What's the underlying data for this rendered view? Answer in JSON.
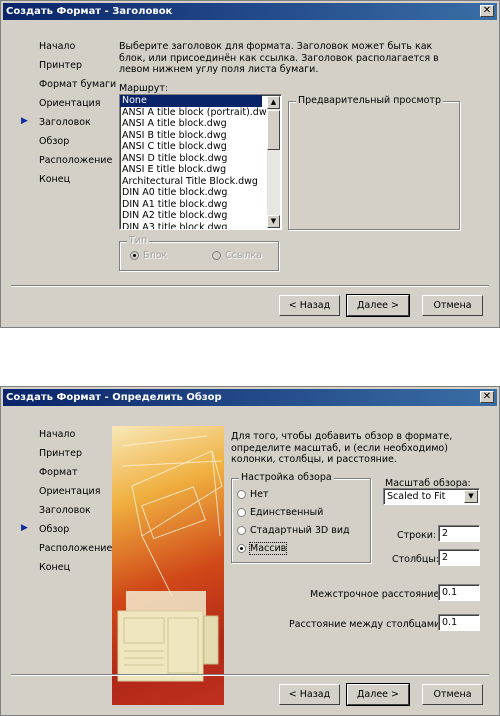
{
  "dialog1": {
    "title": "Создать Формат - Заголовок",
    "nav": [
      "Начало",
      "Принтер",
      "Формат бумаги",
      "Ориентация",
      "Заголовок",
      "Обзор",
      "Расположение",
      "Конец"
    ],
    "active_index": 4,
    "description": "Выберите заголовок для формата. Заголовок может быть как блок, или присоединён как ссылка. Заголовок располагается в левом нижнем углу поля листа бумаги.",
    "path_label": "Маршрут:",
    "list_items": [
      "None",
      "ANSI A title block (portrait).dwg",
      "ANSI A title block.dwg",
      "ANSI B title block.dwg",
      "ANSI C title block.dwg",
      "ANSI D title block.dwg",
      "ANSI E title block.dwg",
      "Architectural Title Block.dwg",
      "DIN A0 title block.dwg",
      "DIN A1 title block.dwg",
      "DIN A2 title block.dwg",
      "DIN A3 title block.dwg"
    ],
    "selected_item": "None",
    "preview_label": "Предварительный просмотр",
    "type_group": "Тип",
    "type_options": [
      "Блок",
      "Ссылка"
    ],
    "back": "< Назад",
    "next": "Далее >",
    "cancel": "Отмена"
  },
  "dialog2": {
    "title": "Создать Формат - Определить Обзор",
    "nav": [
      "Начало",
      "Принтер",
      "Формат",
      "Ориентация",
      "Заголовок",
      "Обзор",
      "Расположение",
      "Конец"
    ],
    "active_index": 5,
    "description": "Для того, чтобы добавить обзор в формате, определите масштаб, и (если необходимо) колонки, столбцы, и расстояние.",
    "view_group": "Настройка обзора",
    "view_options": [
      "Нет",
      "Единственный",
      "Стадартный 3D вид",
      "Массив"
    ],
    "view_selected": "Массив",
    "scale_label": "Масштаб обзора:",
    "scale_value": "Scaled to Fit",
    "rows_label": "Строки:",
    "rows_value": "2",
    "cols_label": "Столбцы:",
    "cols_value": "2",
    "row_spacing_label": "Межстрочное расстояние:",
    "row_spacing_value": "0.1",
    "col_spacing_label": "Расстояние между столбцами:",
    "col_spacing_value": "0.1",
    "back": "< Назад",
    "next": "Далее >",
    "cancel": "Отмена"
  },
  "colors": {
    "titlebar": "#0a246a",
    "dialog_bg": "#d4d0c8",
    "selection": "#0a246a",
    "arrow": "#1030a0"
  }
}
